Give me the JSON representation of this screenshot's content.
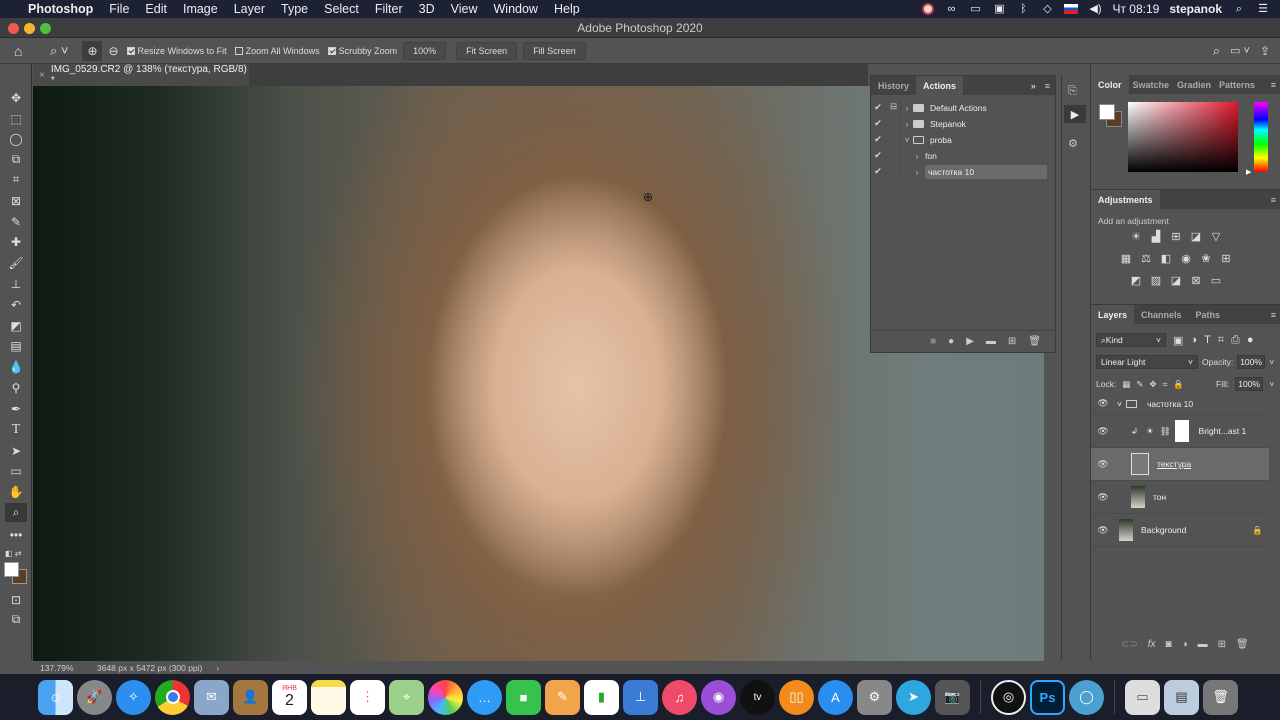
{
  "menubar": {
    "app_name": "Photoshop",
    "items": [
      "File",
      "Edit",
      "Image",
      "Layer",
      "Type",
      "Select",
      "Filter",
      "3D",
      "View",
      "Window",
      "Help"
    ],
    "clock": "Чт 08:19",
    "user": "stepanok",
    "status_icons": [
      "obs-icon",
      "creative-cloud-icon",
      "display-icon",
      "screen-share-icon",
      "bluetooth-icon",
      "wifi-icon",
      "keyboard-layout-ru-icon",
      "volume-icon"
    ]
  },
  "window": {
    "title": "Adobe Photoshop 2020"
  },
  "options_bar": {
    "resize_windows_to_fit": {
      "label": "Resize Windows to Fit",
      "checked": true
    },
    "zoom_all_windows": {
      "label": "Zoom All Windows",
      "checked": false
    },
    "scrubby_zoom": {
      "label": "Scrubby Zoom",
      "checked": true
    },
    "zoom_100_label": "100%",
    "fit_screen_label": "Fit Screen",
    "fill_screen_label": "Fill Screen"
  },
  "document": {
    "tab_title": "IMG_0529.CR2 @ 138% (текстура, RGB/8) *",
    "close_glyph": "×"
  },
  "status_bar": {
    "zoom": "137.79%",
    "doc_info": "3648 px x 5472 px (300 ppi)",
    "arrow": "›"
  },
  "actions_panel": {
    "tabs": [
      "History",
      "Actions"
    ],
    "active_tab": "Actions",
    "rows": [
      {
        "label": "Default Actions",
        "type": "set",
        "expanded": false
      },
      {
        "label": "Stepanok",
        "type": "set",
        "expanded": false
      },
      {
        "label": "proba",
        "type": "set",
        "expanded": true
      },
      {
        "label": "fon",
        "type": "action",
        "expanded": false
      },
      {
        "label": "частотка 10",
        "type": "action",
        "expanded": false,
        "selected": true
      }
    ]
  },
  "color_panel": {
    "tabs": [
      "Color",
      "Swatche",
      "Gradien",
      "Patterns"
    ],
    "active_tab": "Color",
    "foreground": "#ffffff",
    "background": "#5a3f28"
  },
  "adjustments_panel": {
    "title": "Adjustments",
    "hint": "Add an adjustment"
  },
  "layers_panel": {
    "tabs": [
      "Layers",
      "Channels",
      "Paths"
    ],
    "active_tab": "Layers",
    "filter_kind": "Kind",
    "blend_mode": "Linear Light",
    "opacity_label": "Opacity:",
    "opacity": "100%",
    "lock_label": "Lock:",
    "fill_label": "Fill:",
    "fill": "100%",
    "layers": [
      {
        "name": "частотка 10",
        "type": "group",
        "visible": true
      },
      {
        "name": "Bright...ast 1",
        "type": "adjustment",
        "visible": true,
        "clipped": true
      },
      {
        "name": "текстура",
        "type": "pixel",
        "visible": true,
        "selected": true
      },
      {
        "name": "тон",
        "type": "pixel",
        "visible": true
      },
      {
        "name": "Background",
        "type": "pixel",
        "visible": true,
        "locked": true
      }
    ]
  },
  "dock": {
    "apps": [
      "Finder",
      "Launchpad",
      "Safari",
      "Chrome",
      "Mail",
      "Contacts",
      "Calendar",
      "Notes",
      "Reminders",
      "Maps",
      "Photos",
      "Messages",
      "FaceTime",
      "Pages",
      "Numbers",
      "Keynote",
      "Music",
      "Podcasts",
      "TV",
      "Books",
      "App Store",
      "System Preferences",
      "Telegram",
      "Image Capture",
      "OBS",
      "Photoshop",
      "Camo",
      "Downloads",
      "Preview",
      "Trash"
    ],
    "calendar_month": "ЯНВ",
    "calendar_day": "2"
  }
}
